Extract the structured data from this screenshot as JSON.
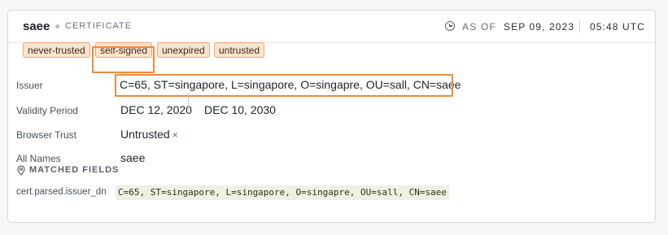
{
  "header": {
    "name": "saee",
    "kind": "CERTIFICATE",
    "as_of_label": "AS OF",
    "date": "SEP 09, 2023",
    "time": "05:48 UTC",
    "clock_icon": "clock-icon"
  },
  "tags": [
    "never-trusted",
    "self-signed",
    "unexpired",
    "untrusted"
  ],
  "fields": {
    "issuer": {
      "label": "Issuer",
      "value": "C=65, ST=singapore, L=singapore, O=singapre, OU=sall, CN=saee"
    },
    "validity": {
      "label": "Validity Period",
      "start": "DEC 12, 2020",
      "end": "DEC 10, 2030"
    },
    "browser_trust": {
      "label": "Browser Trust",
      "value": "Untrusted",
      "mark": "×"
    },
    "all_names": {
      "label": "All Names",
      "value": "saee"
    }
  },
  "matched": {
    "heading": "MATCHED FIELDS",
    "icon": "location-pin-icon",
    "key": "cert.parsed.issuer_dn",
    "value": "C=65, ST=singapore, L=singapore, O=singapre, OU=sall, CN=saee"
  },
  "colors": {
    "tag_bg": "#fde3cc",
    "tag_border": "#e8a77a",
    "highlight": "#f08a3c",
    "untrusted_mark": "#d9342b"
  }
}
